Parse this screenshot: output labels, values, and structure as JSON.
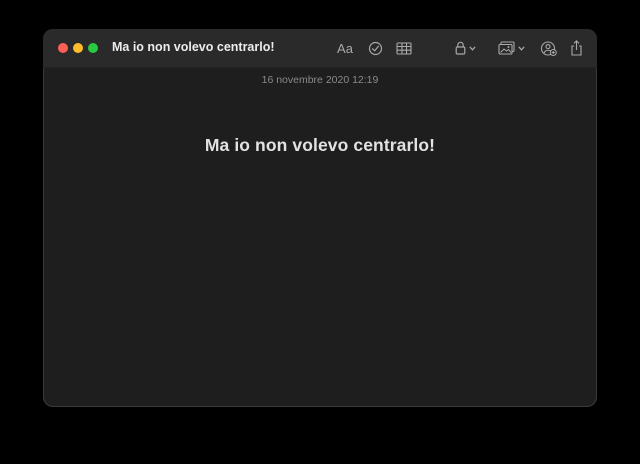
{
  "window": {
    "title": "Ma io non volevo centrarlo!"
  },
  "toolbar": {
    "format_label": "Aa",
    "icons": [
      "checklist-icon",
      "table-icon",
      "lock-icon",
      "media-icon",
      "collaborate-icon",
      "share-icon"
    ]
  },
  "note": {
    "timestamp": "16 novembre 2020 12:19",
    "heading": "Ma io non volevo centrarlo!"
  },
  "colors": {
    "background": "#000000",
    "window": "#1e1e1e",
    "titlebar": "#2a2a2a",
    "close": "#fe5f57",
    "minimize": "#febc2e",
    "maximize": "#28c840"
  }
}
